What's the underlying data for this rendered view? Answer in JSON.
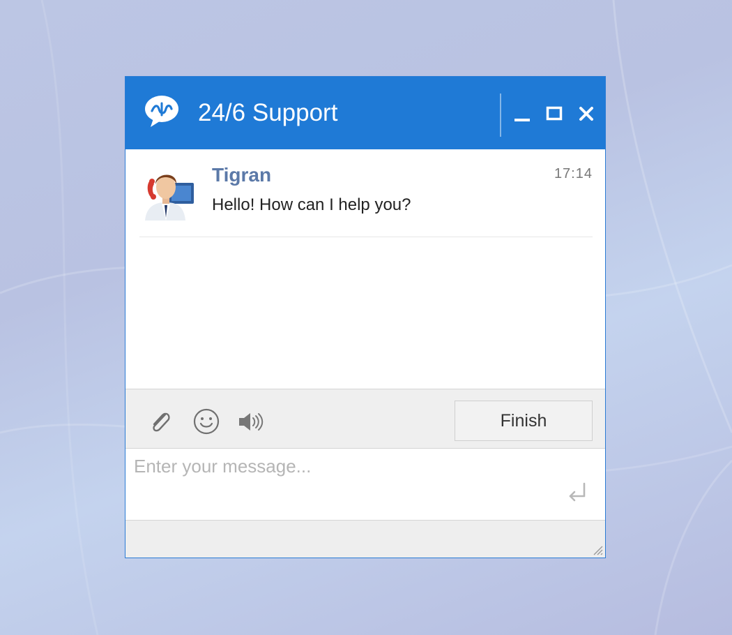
{
  "window": {
    "title": "24/6 Support",
    "accent_color": "#1f7ad6",
    "logo_icon": "chat-bubble-logo-icon",
    "controls": {
      "minimize_icon": "minimize-icon",
      "maximize_icon": "maximize-icon",
      "close_icon": "close-icon"
    }
  },
  "messages": [
    {
      "sender": "Tigran",
      "time": "17:14",
      "text": "Hello! How can I help you?",
      "avatar_icon": "support-agent-avatar"
    }
  ],
  "toolbar": {
    "icons": [
      "paperclip-icon",
      "smiley-icon",
      "speaker-icon"
    ],
    "finish_label": "Finish"
  },
  "composer": {
    "placeholder": "Enter your message...",
    "value": "",
    "send_icon": "enter-return-icon"
  }
}
